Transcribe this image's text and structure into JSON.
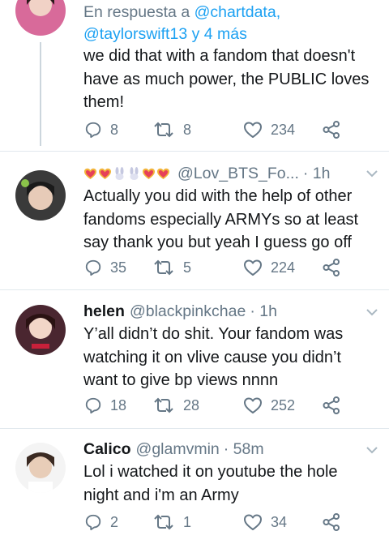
{
  "tweets": [
    {
      "reply_prefix": "En respuesta a ",
      "reply_handle1": "@chartdata,",
      "reply_handle2": "@taylorswift13",
      "reply_suffix": " y 4 más",
      "lines": [
        "we did that with a fandom that doesn't",
        "have as much power, the PUBLIC loves",
        "them!"
      ],
      "replies": "8",
      "retweets": "8",
      "likes": "234"
    },
    {
      "name_emojis": [
        "heart-sparkle",
        "heart-sparkle",
        "rabbit",
        "rabbit",
        "heart-sparkle",
        "heart-sparkle"
      ],
      "handle": "@Lov_BTS_Fo...",
      "time": "· 1h",
      "lines": [
        "Actually you did with the help of other",
        "fandoms especially ARMYs so at least",
        "say thank you but yeah I guess go off"
      ],
      "replies": "35",
      "retweets": "5",
      "likes": "224"
    },
    {
      "name": "helen",
      "handle": "@blackpinkchae",
      "time": "· 1h",
      "lines": [
        "Y’all didn’t do shit. Your fandom was",
        "watching it on vlive cause you didn’t",
        "want to give bp views nnnn"
      ],
      "replies": "18",
      "retweets": "28",
      "likes": "252"
    },
    {
      "name": "Calico",
      "handle": "@glamvmin",
      "time": "· 58m",
      "lines": [
        "Lol i watched it on youtube the hole",
        "night and i'm an Army"
      ],
      "replies": "2",
      "retweets": "1",
      "likes": "34"
    }
  ],
  "colors": {
    "text": "#14171a",
    "secondary": "#657786",
    "link": "#1da1f2",
    "divider": "#e1e8ed"
  }
}
